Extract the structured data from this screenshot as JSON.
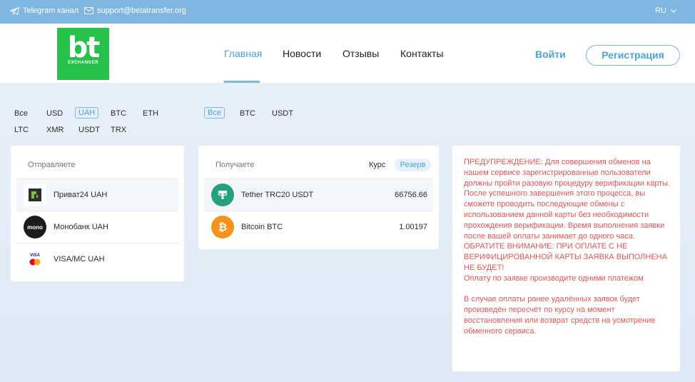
{
  "topbar": {
    "telegram": "Telegram канал",
    "email": "support@betatransfer.org",
    "lang": "RU"
  },
  "logo": {
    "main": "bt",
    "sub": "EXCHANGER"
  },
  "nav": [
    "Главная",
    "Новости",
    "Отзывы",
    "Контакты"
  ],
  "auth": {
    "login": "Войти",
    "register": "Регистрация"
  },
  "filters_send": [
    "Все",
    "USD",
    "UAH",
    "BTC",
    "ETH",
    "LTC",
    "XMR",
    "USDT",
    "TRX"
  ],
  "filters_send_selected": "UAH",
  "filters_receive": [
    "Все",
    "BTC",
    "USDT"
  ],
  "filters_receive_selected": "Все",
  "send": {
    "title": "Отправляете",
    "items": [
      {
        "name": "Приват24 UAH",
        "icon": "privat24-icon"
      },
      {
        "name": "Монобанк UAH",
        "icon": "monobank-icon",
        "icon_text": "mono"
      },
      {
        "name": "VISA/MC UAH",
        "icon": "visa-mastercard-icon",
        "icon_text": "VISA"
      }
    ]
  },
  "receive": {
    "title": "Получаете",
    "rate_label": "Курс",
    "reserve_label": "Резерв",
    "items": [
      {
        "name": "Tether TRC20 USDT",
        "icon": "tether-icon",
        "value": "66756.66",
        "color": "#26a17b"
      },
      {
        "name": "Bitcoin BTC",
        "icon": "bitcoin-icon",
        "value": "1.00197",
        "color": "#f7931a"
      }
    ]
  },
  "warning": {
    "p1": "ПРЕДУПРЕЖДЕНИЕ: Для совершения обменов на нашем сервисе зарегистрированные пользователи должны пройти разовую процедуру верификации карты. После успешного завершения этого процесса, вы сможете проводить последующие обмены с использованием данной карты без необходимости прохождения верификации. Время выполнения заявки после вашей оплаты занимает до одного часа.",
    "p2": "ОБРАТИТЕ ВНИМАНИЕ: ПРИ ОПЛАТЕ С НЕ ВЕРИФИЦИРОВАННОЙ КАРТЫ ЗАЯВКА ВЫПОЛНЕНА НЕ БУДЕТ!",
    "p3": "Оплату по заявке производите одними платежом",
    "p4": "В случае оплаты ранее удалённых заявок будет произведён пересчёт по курсу на момент восстановления или возврат средств на усмотрение обменного сервиса."
  },
  "colors": {
    "accent": "#4aa3dd",
    "topbar": "#7fb6e2",
    "brand": "#25c24b",
    "warning": "#e25555"
  }
}
